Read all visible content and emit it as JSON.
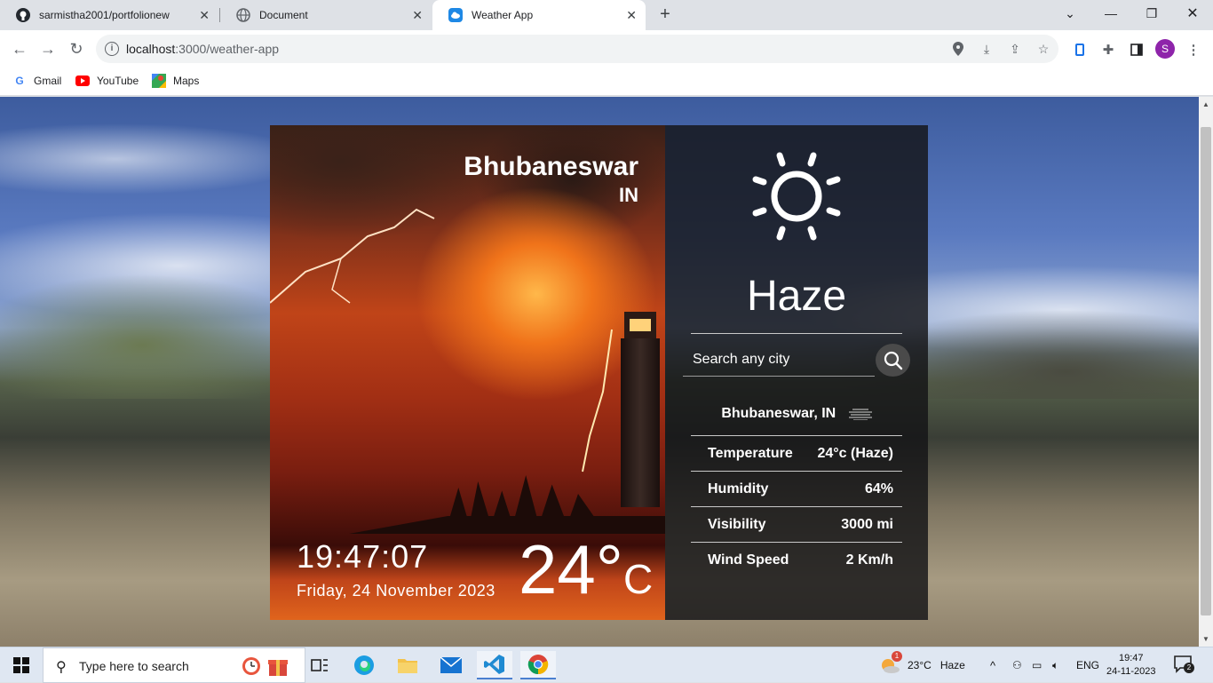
{
  "browser": {
    "tabs": [
      {
        "title": "sarmistha2001/portfolionew",
        "icon": "github-icon"
      },
      {
        "title": "Document",
        "icon": "globe-icon"
      },
      {
        "title": "Weather App",
        "icon": "weather-icon"
      }
    ],
    "url_host": "localhost",
    "url_rest": ":3000/weather-app",
    "avatar": "S",
    "bookmarks": [
      {
        "label": "Gmail",
        "icon": "google-icon"
      },
      {
        "label": "YouTube",
        "icon": "youtube-icon"
      },
      {
        "label": "Maps",
        "icon": "maps-icon"
      }
    ]
  },
  "weather": {
    "city": "Bhubaneswar",
    "country": "IN",
    "time": "19:47:07",
    "date": "Friday, 24 November 2023",
    "temp": "24°",
    "temp_unit": "C",
    "condition": "Haze",
    "search_placeholder": "Search any city",
    "location_line": "Bhubaneswar, IN",
    "details": [
      {
        "label": "Temperature",
        "value": "24°c (Haze)"
      },
      {
        "label": "Humidity",
        "value": "64%"
      },
      {
        "label": "Visibility",
        "value": "3000 mi"
      },
      {
        "label": "Wind Speed",
        "value": "2 Km/h"
      }
    ]
  },
  "taskbar": {
    "search_placeholder": "Type here to search",
    "weather_temp": "23°C",
    "weather_cond": "Haze",
    "lang": "ENG",
    "clock_time": "19:47",
    "clock_date": "24-11-2023",
    "notif_count": "2",
    "weather_badge": "1"
  },
  "colors": {
    "accent": "#1a73e8",
    "avatar": "#8e24aa"
  }
}
